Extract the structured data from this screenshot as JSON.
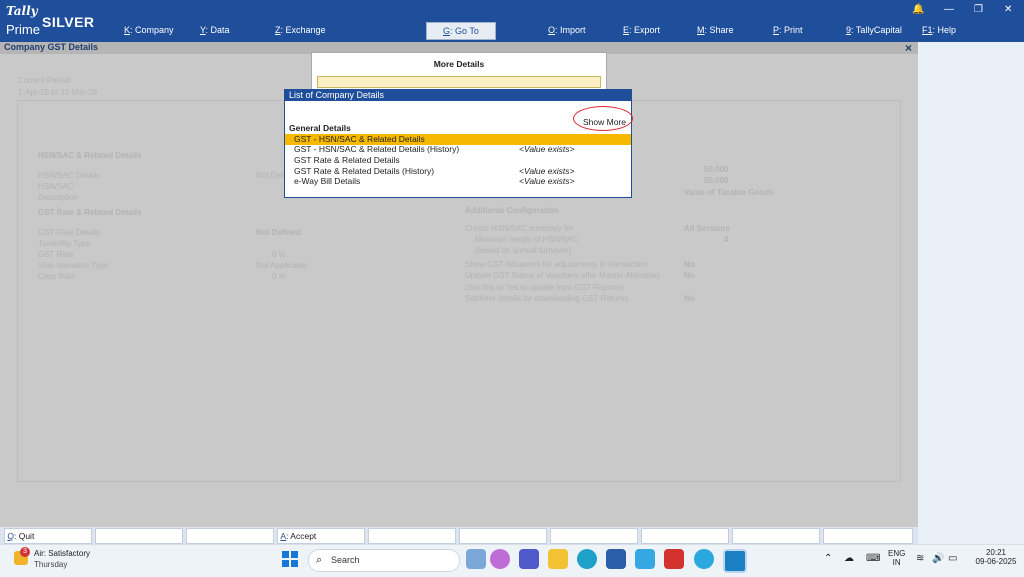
{
  "app": {
    "brand_top": "Tally",
    "brand_bottom": "Prime",
    "edition": "SILVER"
  },
  "menu": [
    {
      "key": "K",
      "label": ": Company"
    },
    {
      "key": "Y",
      "label": ": Data"
    },
    {
      "key": "Z",
      "label": ": Exchange"
    },
    {
      "key": "G",
      "label": ": Go To"
    },
    {
      "key": "O",
      "label": ": Import"
    },
    {
      "key": "E",
      "label": ": Export"
    },
    {
      "key": "M",
      "label": ": Share"
    },
    {
      "key": "P",
      "label": ": Print"
    },
    {
      "key": "9",
      "label": ": TallyCapital"
    },
    {
      "key": "F1",
      "label": ": Help"
    }
  ],
  "window": {
    "title": "Company GST Details",
    "close": "×"
  },
  "background": {
    "period_label": "Current Period",
    "period_value": "1-Apr-25 to 31-Mar-26",
    "hsn_section": "HSN/SAC & Related Details",
    "hsn_rows": [
      "HSN/SAC Details",
      "HSN/SAC",
      "Description"
    ],
    "hsn_value": "Not Defined",
    "gst_section": "GST Rate & Related Details",
    "gst_rows": [
      "GST Rate Details",
      "Taxability Type",
      "GST Rate",
      "Slab Valuation Type",
      "Cess Rate"
    ],
    "gst_values": [
      "Not Defined",
      "",
      "0 %",
      "Not Applicable",
      "0 %"
    ],
    "right_values": [
      "50,000",
      "50,000"
    ],
    "right_caption": "Value of Taxable Goods",
    "addl_section": "Additional Configuration",
    "addl_rows": [
      "Create HSN/SAC summary for",
      "Minimum length of HSN/SAC",
      "(based on annual turnover)",
      "Show GST Advances for adjustments in transaction",
      "Update GST Status of Vouchers after Master Alteration",
      "(Set this to Yes to update from GST Reports)",
      "Set/Alter details for downloading GST Returns"
    ],
    "addl_values": [
      "All Sections",
      "4",
      "",
      "No",
      "No",
      "",
      "No"
    ]
  },
  "more_details": {
    "title": "More Details",
    "input_value": ""
  },
  "list": {
    "title": "List of Company Details",
    "show_more": "Show More",
    "section": "General Details",
    "items": [
      {
        "label": "GST - HSN/SAC & Related Details",
        "value": ""
      },
      {
        "label": "GST - HSN/SAC & Related Details (History)",
        "value": "<Value exists>"
      },
      {
        "label": "GST Rate & Related Details",
        "value": ""
      },
      {
        "label": "GST Rate & Related Details (History)",
        "value": "<Value exists>"
      },
      {
        "label": "e-Way Bill Details",
        "value": "<Value exists>"
      }
    ]
  },
  "buttons": {
    "quit_key": "Q",
    "quit_label": ": Quit",
    "accept_key": "A",
    "accept_label": ": Accept"
  },
  "taskbar": {
    "weather_line1": "Air: Satisfactory",
    "weather_line2": "Thursday",
    "weather_badge": "3",
    "search_placeholder": "Search",
    "lang_top": "ENG",
    "lang_bottom": "IN",
    "time": "20:21",
    "date": "09-06-2025"
  },
  "colors": {
    "header": "#1f4e9b",
    "selection": "#f6b900",
    "annotation": "#e0262d"
  }
}
